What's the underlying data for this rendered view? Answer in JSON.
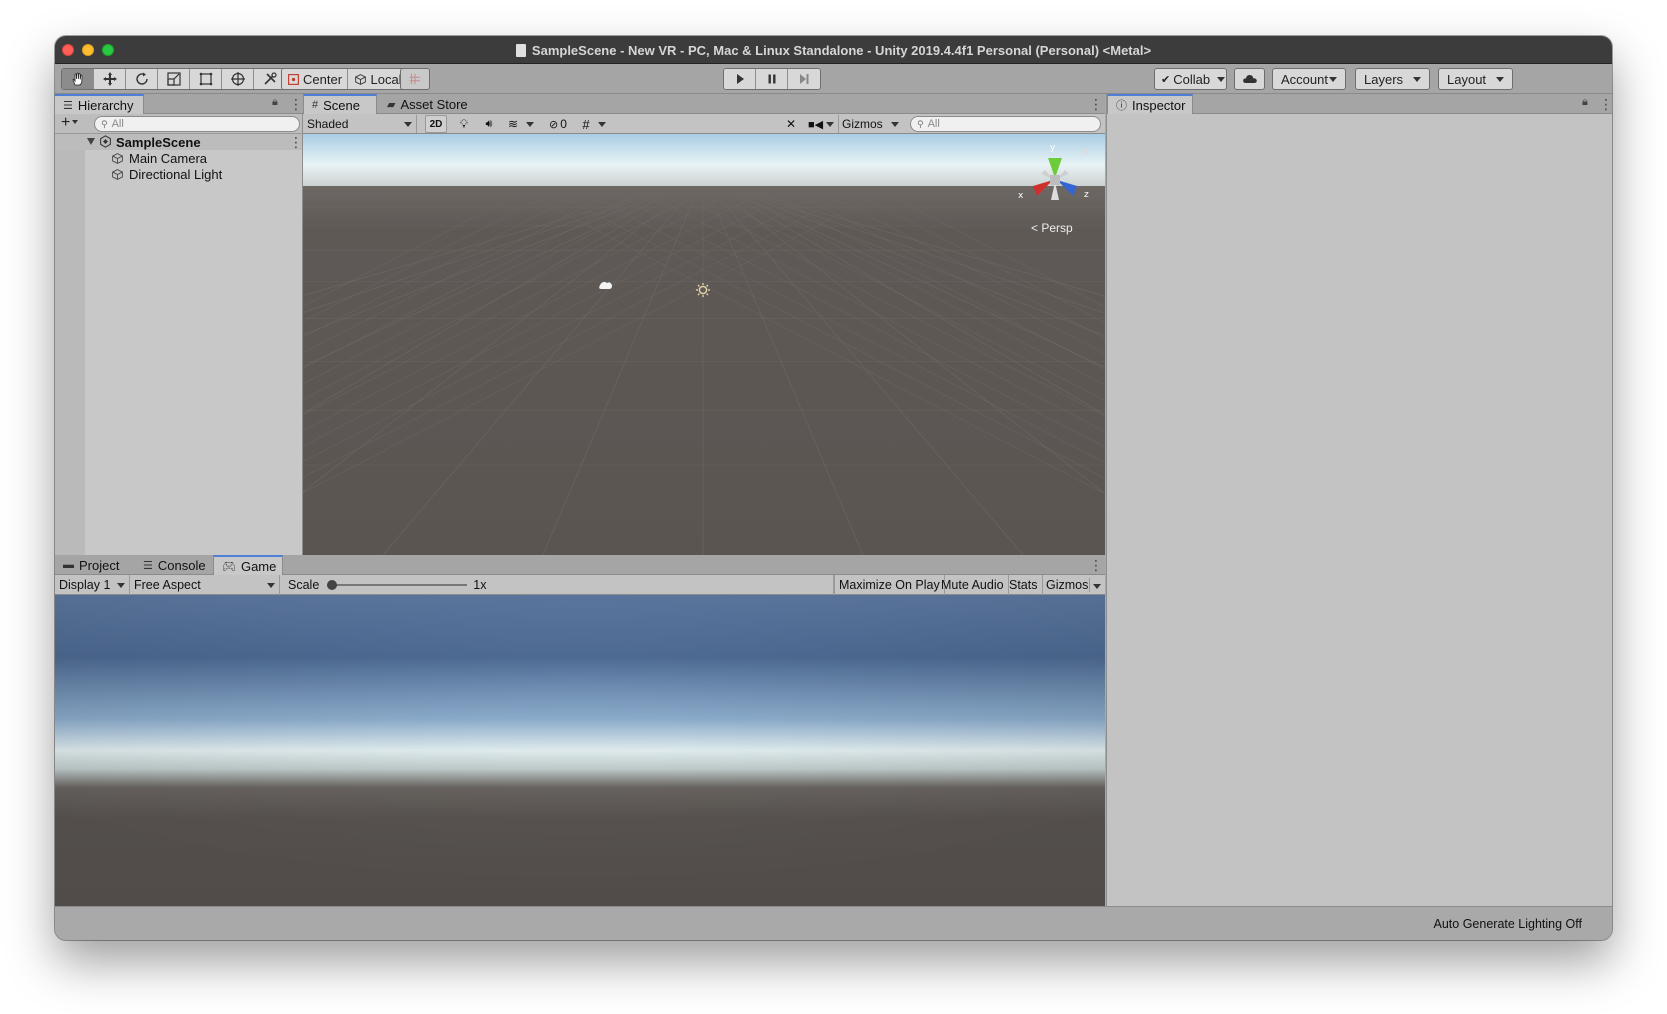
{
  "window": {
    "title": "SampleScene - New VR - PC, Mac & Linux Standalone - Unity 2019.4.4f1 Personal (Personal) <Metal>"
  },
  "toolbar": {
    "tools": [
      "hand-tool",
      "move-tool",
      "rotate-tool",
      "scale-tool",
      "rect-tool",
      "transform-tool",
      "custom-tool"
    ],
    "pivot_mode": "Center",
    "pivot_rotation": "Local",
    "collab_label": "Collab",
    "account_label": "Account",
    "layers_label": "Layers",
    "layout_label": "Layout"
  },
  "hierarchy": {
    "tab_label": "Hierarchy",
    "search_placeholder": "All",
    "scene_name": "SampleScene",
    "items": [
      {
        "label": "Main Camera"
      },
      {
        "label": "Directional Light"
      }
    ]
  },
  "scene": {
    "tabs": [
      {
        "label": "Scene"
      },
      {
        "label": "Asset Store"
      }
    ],
    "draw_mode": "Shaded",
    "two_d_label": "2D",
    "hidden_count": "0",
    "gizmos_label": "Gizmos",
    "search_placeholder": "All",
    "projection_label": "Persp",
    "axis_labels": {
      "x": "x",
      "y": "y",
      "z": "z"
    }
  },
  "inspector": {
    "tab_label": "Inspector"
  },
  "bottom": {
    "tabs": [
      {
        "label": "Project"
      },
      {
        "label": "Console"
      },
      {
        "label": "Game"
      }
    ],
    "display_label": "Display 1",
    "aspect_label": "Free Aspect",
    "scale_label": "Scale",
    "scale_value": "1x",
    "maximize_label": "Maximize On Play",
    "mute_label": "Mute Audio",
    "stats_label": "Stats",
    "gizmos_label": "Gizmos"
  },
  "status": {
    "lighting_text": "Auto Generate Lighting Off"
  },
  "colors": {
    "accent_tab": "#4d7fd6",
    "scene_ground": "#5c5653",
    "sky_horizon": "#e4f1f3",
    "sky_top": "#5c7ba3",
    "axis_x": "#d0302b",
    "axis_y": "#6ecb3a",
    "axis_z": "#3565d0"
  }
}
